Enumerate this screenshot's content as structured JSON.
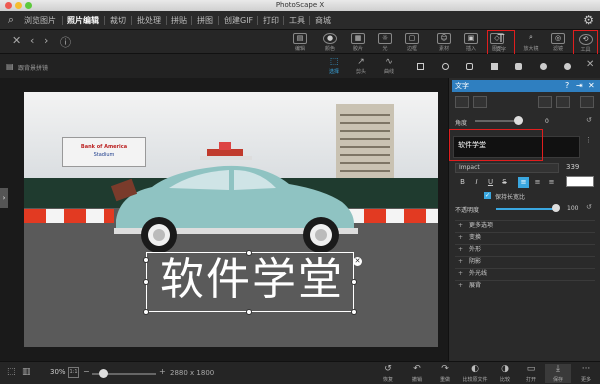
{
  "window": {
    "title": "PhotoScape X"
  },
  "menu": {
    "items": [
      "浏览图片",
      "照片编辑",
      "裁切",
      "批处理",
      "拼贴",
      "拼图",
      "创建GIF",
      "打印",
      "工具",
      "商城"
    ],
    "active_index": 1
  },
  "toolbar": {
    "tools": [
      "编辑",
      "颜色",
      "胶片",
      "光",
      "边框",
      "素材",
      "插入",
      "图形",
      "文字",
      "放大镜",
      "滤镜",
      "工具"
    ]
  },
  "subbar": {
    "left_label": "跟背景拼镜",
    "tools": [
      "选择",
      "剪头",
      "曲线"
    ]
  },
  "image": {
    "sign_line1": "Bank of America",
    "sign_line2": "Stadium",
    "overlay_text": "软件学堂"
  },
  "bottom": {
    "zoom": "30%",
    "zoom_box": "1:1",
    "dimensions": "2880 x 1800",
    "buttons": [
      "恢复",
      "撤销",
      "重做",
      "比较原文件",
      "比较",
      "打开",
      "保存",
      "更多"
    ]
  },
  "panel": {
    "title": "文字",
    "angle_label": "角度",
    "angle_value": "0",
    "text_value": "软件学堂",
    "font": "Impact",
    "font_size": "339",
    "keep_aspect": "保持长宽比",
    "opacity_label": "不透明度",
    "opacity_value": "100",
    "options": [
      "更多选项",
      "变换",
      "外形",
      "阴影",
      "外光线",
      "展背"
    ]
  },
  "colors": {
    "accent": "#3aa7e0",
    "highlight": "#e01e1e",
    "text_color": "#ffffff"
  }
}
